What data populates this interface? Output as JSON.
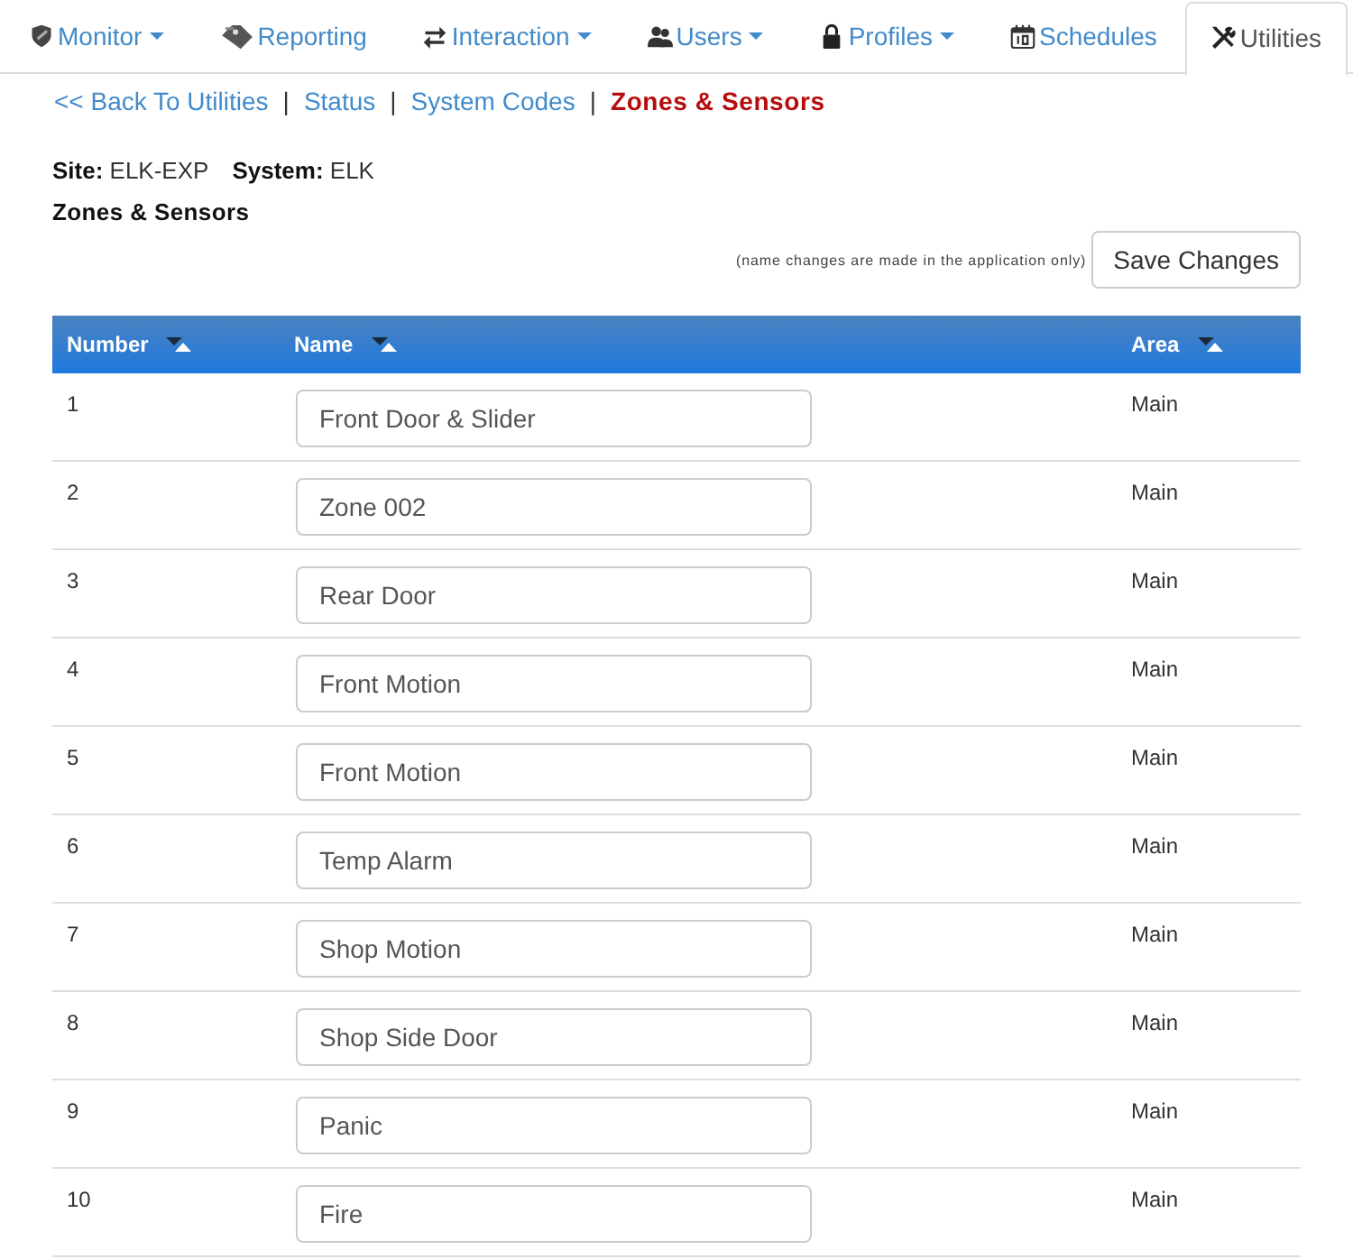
{
  "tabs": [
    {
      "label": "Monitor",
      "dropdown": true,
      "selected": false
    },
    {
      "label": "Reporting",
      "dropdown": false,
      "selected": false
    },
    {
      "label": "Interaction",
      "dropdown": true,
      "selected": false
    },
    {
      "label": "Users",
      "dropdown": true,
      "selected": false
    },
    {
      "label": "Profiles",
      "dropdown": true,
      "selected": false
    },
    {
      "label": "Schedules",
      "dropdown": false,
      "selected": false
    },
    {
      "label": "Utilities",
      "dropdown": false,
      "selected": true
    }
  ],
  "breadcrumb": [
    {
      "label": "<< Back To Utilities",
      "selected": false
    },
    {
      "separator": "|",
      "label": "Status",
      "selected": false
    },
    {
      "separator": "|",
      "label": "System Codes",
      "selected": false
    },
    {
      "separator": "|",
      "label": "Zones & Sensors",
      "selected": true
    }
  ],
  "info": {
    "site": "**Site:** ELK-EXP",
    "system": "**System:** ELK"
  },
  "section_title": "Zones & Sensors",
  "note": "(name changes are made in the application only)",
  "save_button": "Save Changes",
  "table": {
    "columns": [
      {
        "label": "Number"
      },
      {
        "label": "Name"
      },
      {
        "label": "Area"
      }
    ],
    "rows": [
      {
        "number": "1",
        "name": "Front Door & Slider",
        "area": "Main"
      },
      {
        "number": "2",
        "name": "Zone 002",
        "area": "Main"
      },
      {
        "number": "3",
        "name": "Rear Door",
        "area": "Main"
      },
      {
        "number": "4",
        "name": "Front Motion",
        "area": "Main"
      },
      {
        "number": "5",
        "name": "Front Motion",
        "area": "Main"
      },
      {
        "number": "6",
        "name": "Temp Alarm",
        "area": "Main"
      },
      {
        "number": "7",
        "name": "Shop Motion",
        "area": "Main"
      },
      {
        "number": "8",
        "name": "Shop Side Door",
        "area": "Main"
      },
      {
        "number": "9",
        "name": "Panic",
        "area": "Main"
      },
      {
        "number": "10",
        "name": "Fire",
        "area": "Main"
      }
    ]
  }
}
